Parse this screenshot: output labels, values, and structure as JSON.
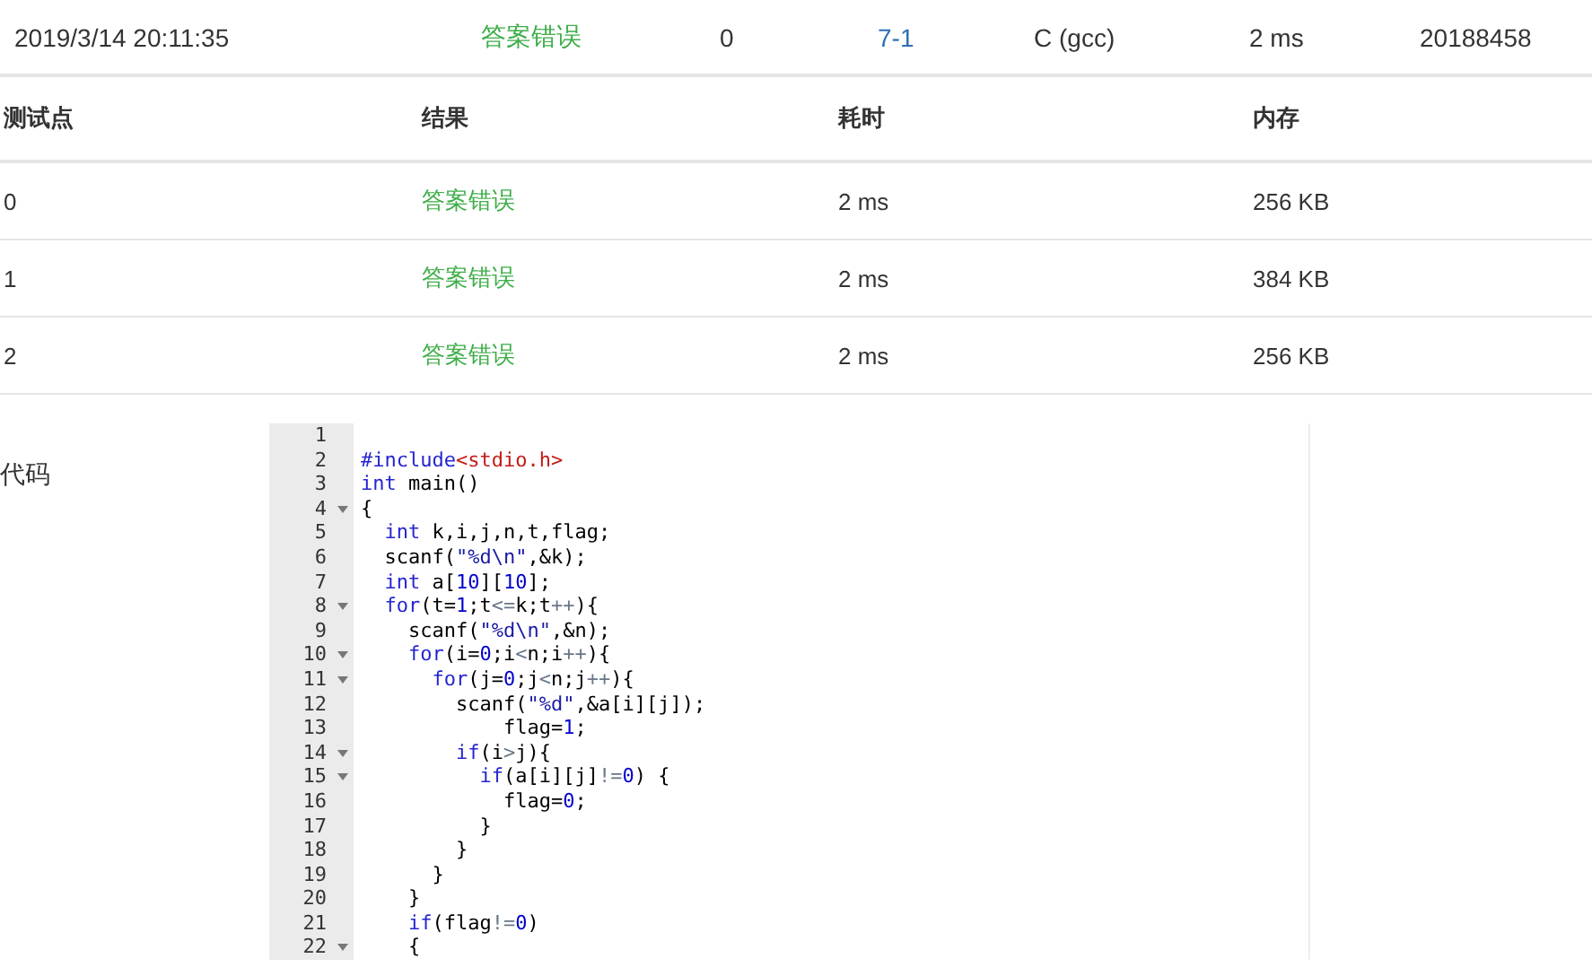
{
  "submission": {
    "time": "2019/3/14 20:11:35",
    "status": "答案错误",
    "score": "0",
    "problem": "7-1",
    "compiler": "C (gcc)",
    "duration": "2 ms",
    "user": "20188458"
  },
  "cases": {
    "columns": [
      "测试点",
      "结果",
      "耗时",
      "内存"
    ],
    "rows": [
      {
        "case": "0",
        "result": "答案错误",
        "time": "2 ms",
        "memory": "256 KB"
      },
      {
        "case": "1",
        "result": "答案错误",
        "time": "2 ms",
        "memory": "384 KB"
      },
      {
        "case": "2",
        "result": "答案错误",
        "time": "2 ms",
        "memory": "256 KB"
      }
    ]
  },
  "code": {
    "label": "代码",
    "lines": [
      {
        "number": "1",
        "fold": false
      },
      {
        "number": "2",
        "fold": false,
        "tokens": [
          {
            "kind": "directive",
            "text": "#include"
          },
          {
            "kind": "header",
            "text": "<stdio.h>"
          }
        ]
      },
      {
        "number": "3",
        "fold": false,
        "tokens": [
          {
            "kind": "keyword",
            "text": "int"
          },
          {
            "kind": "plain",
            "text": " main()"
          }
        ]
      },
      {
        "number": "4",
        "fold": true,
        "tokens": [
          {
            "kind": "plain",
            "text": "{"
          }
        ]
      },
      {
        "number": "5",
        "fold": false,
        "tokens": [
          {
            "kind": "keyword",
            "text": "  int"
          },
          {
            "kind": "plain",
            "text": " k,i,j,n,t,flag;"
          }
        ]
      },
      {
        "number": "6",
        "fold": false,
        "tokens": [
          {
            "kind": "plain",
            "text": "  scanf("
          },
          {
            "kind": "string",
            "text": "\"%d\\n\""
          },
          {
            "kind": "plain",
            "text": ",&k);"
          }
        ]
      },
      {
        "number": "7",
        "fold": false,
        "tokens": [
          {
            "kind": "keyword",
            "text": "  int"
          },
          {
            "kind": "plain",
            "text": " a["
          },
          {
            "kind": "number",
            "text": "10"
          },
          {
            "kind": "plain",
            "text": "]["
          },
          {
            "kind": "number",
            "text": "10"
          },
          {
            "kind": "plain",
            "text": "];"
          }
        ]
      },
      {
        "number": "8",
        "fold": true,
        "tokens": [
          {
            "kind": "keyword",
            "text": "  for"
          },
          {
            "kind": "plain",
            "text": "(t="
          },
          {
            "kind": "number",
            "text": "1"
          },
          {
            "kind": "plain",
            "text": ";t"
          },
          {
            "kind": "operator",
            "text": "<="
          },
          {
            "kind": "plain",
            "text": "k;t"
          },
          {
            "kind": "operator",
            "text": "++"
          },
          {
            "kind": "plain",
            "text": "){"
          }
        ]
      },
      {
        "number": "9",
        "fold": false,
        "tokens": [
          {
            "kind": "plain",
            "text": "    scanf("
          },
          {
            "kind": "string",
            "text": "\"%d\\n\""
          },
          {
            "kind": "plain",
            "text": ",&n);"
          }
        ]
      },
      {
        "number": "10",
        "fold": true,
        "tokens": [
          {
            "kind": "keyword",
            "text": "    for"
          },
          {
            "kind": "plain",
            "text": "(i="
          },
          {
            "kind": "number",
            "text": "0"
          },
          {
            "kind": "plain",
            "text": ";i"
          },
          {
            "kind": "operator",
            "text": "<"
          },
          {
            "kind": "plain",
            "text": "n;i"
          },
          {
            "kind": "operator",
            "text": "++"
          },
          {
            "kind": "plain",
            "text": "){"
          }
        ]
      },
      {
        "number": "11",
        "fold": true,
        "tokens": [
          {
            "kind": "keyword",
            "text": "      for"
          },
          {
            "kind": "plain",
            "text": "(j="
          },
          {
            "kind": "number",
            "text": "0"
          },
          {
            "kind": "plain",
            "text": ";j"
          },
          {
            "kind": "operator",
            "text": "<"
          },
          {
            "kind": "plain",
            "text": "n;j"
          },
          {
            "kind": "operator",
            "text": "++"
          },
          {
            "kind": "plain",
            "text": "){"
          }
        ]
      },
      {
        "number": "12",
        "fold": false,
        "tokens": [
          {
            "kind": "plain",
            "text": "        scanf("
          },
          {
            "kind": "string",
            "text": "\"%d\""
          },
          {
            "kind": "plain",
            "text": ",&a[i][j]);"
          }
        ]
      },
      {
        "number": "13",
        "fold": false,
        "tokens": [
          {
            "kind": "plain",
            "text": "            flag="
          },
          {
            "kind": "number",
            "text": "1"
          },
          {
            "kind": "plain",
            "text": ";"
          }
        ]
      },
      {
        "number": "14",
        "fold": true,
        "tokens": [
          {
            "kind": "keyword",
            "text": "        if"
          },
          {
            "kind": "plain",
            "text": "(i"
          },
          {
            "kind": "operator",
            "text": ">"
          },
          {
            "kind": "plain",
            "text": "j){"
          }
        ]
      },
      {
        "number": "15",
        "fold": true,
        "tokens": [
          {
            "kind": "keyword",
            "text": "          if"
          },
          {
            "kind": "plain",
            "text": "(a[i][j]"
          },
          {
            "kind": "operator",
            "text": "!="
          },
          {
            "kind": "number",
            "text": "0"
          },
          {
            "kind": "plain",
            "text": ") {"
          }
        ]
      },
      {
        "number": "16",
        "fold": false,
        "tokens": [
          {
            "kind": "plain",
            "text": "            flag="
          },
          {
            "kind": "number",
            "text": "0"
          },
          {
            "kind": "plain",
            "text": ";"
          }
        ]
      },
      {
        "number": "17",
        "fold": false,
        "tokens": [
          {
            "kind": "plain",
            "text": "          }"
          }
        ]
      },
      {
        "number": "18",
        "fold": false,
        "tokens": [
          {
            "kind": "plain",
            "text": "        }"
          }
        ]
      },
      {
        "number": "19",
        "fold": false,
        "tokens": [
          {
            "kind": "plain",
            "text": "      }"
          }
        ]
      },
      {
        "number": "20",
        "fold": false,
        "tokens": [
          {
            "kind": "plain",
            "text": "    }"
          }
        ]
      },
      {
        "number": "21",
        "fold": false,
        "tokens": [
          {
            "kind": "keyword",
            "text": "    if"
          },
          {
            "kind": "plain",
            "text": "(flag"
          },
          {
            "kind": "operator",
            "text": "!="
          },
          {
            "kind": "number",
            "text": "0"
          },
          {
            "kind": "plain",
            "text": ")"
          }
        ]
      },
      {
        "number": "22",
        "fold": true,
        "tokens": [
          {
            "kind": "plain",
            "text": "    {"
          }
        ]
      }
    ]
  }
}
